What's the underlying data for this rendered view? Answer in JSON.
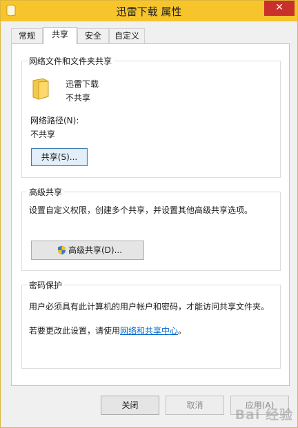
{
  "window": {
    "title": "迅雷下载 属性",
    "close_label": "✕"
  },
  "tabs": [
    {
      "label": "常规",
      "active": false
    },
    {
      "label": "共享",
      "active": true
    },
    {
      "label": "安全",
      "active": false
    },
    {
      "label": "自定义",
      "active": false
    }
  ],
  "network_sharing": {
    "group_title": "网络文件和文件夹共享",
    "folder_name": "迅雷下载",
    "share_status": "不共享",
    "path_label": "网络路径(N):",
    "path_value": "不共享",
    "share_button": "共享(S)..."
  },
  "advanced_sharing": {
    "group_title": "高级共享",
    "description": "设置自定义权限，创建多个共享，并设置其他高级共享选项。",
    "button": "高级共享(D)..."
  },
  "password_protection": {
    "group_title": "密码保护",
    "line1": "用户必须具有此计算机的用户帐户和密码，才能访问共享文件夹。",
    "line2_prefix": "若要更改此设置，请使用",
    "line2_link": "网络和共享中心",
    "line2_suffix": "。"
  },
  "footer": {
    "close_button": "关闭",
    "cancel_button": "取消",
    "apply_button": "应用(A)"
  },
  "watermark": "Bai 经验",
  "colors": {
    "titlebar": "#f7c52b",
    "close_button": "#c9302c",
    "link": "#0066cc",
    "folder": "#f2c94c"
  }
}
